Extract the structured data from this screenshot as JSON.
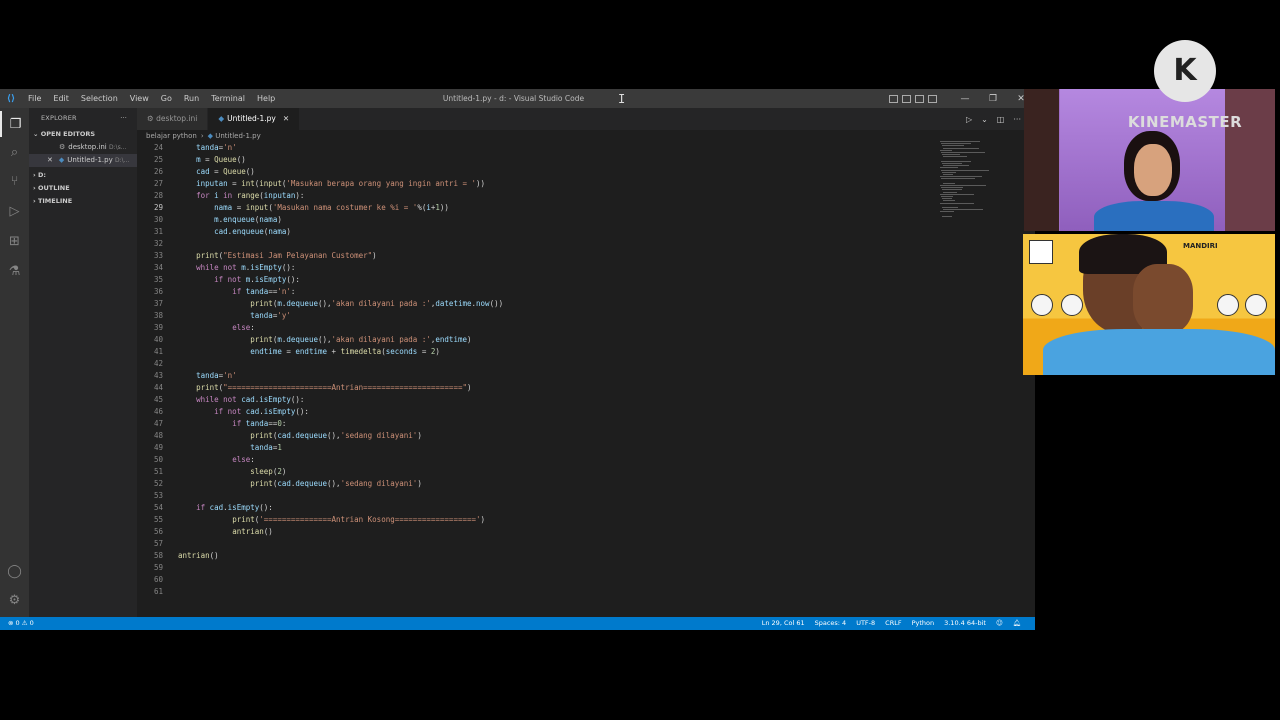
{
  "window": {
    "title": "Untitled-1.py - d: - Visual Studio Code",
    "menu": [
      "File",
      "Edit",
      "Selection",
      "View",
      "Go",
      "Run",
      "Terminal",
      "Help"
    ]
  },
  "sidebar": {
    "header": "EXPLORER",
    "open_editors_label": "OPEN EDITORS",
    "open_editors": [
      {
        "name": "desktop.ini",
        "path": "D:\\s..."
      },
      {
        "name": "Untitled-1.py",
        "path": "D:\\..."
      }
    ],
    "sections": [
      "D:",
      "OUTLINE",
      "TIMELINE"
    ]
  },
  "tabs": [
    {
      "label": "desktop.ini"
    },
    {
      "label": "Untitled-1.py"
    }
  ],
  "breadcrumb": {
    "folder": "belajar python",
    "file": "Untitled-1.py"
  },
  "editor": {
    "lines": [
      {
        "n": "24",
        "indent": 2,
        "text": "tanda='n'"
      },
      {
        "n": "25",
        "indent": 2,
        "text": "m = Queue()"
      },
      {
        "n": "26",
        "indent": 2,
        "text": "cad = Queue()"
      },
      {
        "n": "27",
        "indent": 2,
        "text": "inputan = int(input('Masukan berapa orang yang ingin antri = '))"
      },
      {
        "n": "28",
        "indent": 2,
        "text": "for i in range(inputan):"
      },
      {
        "n": "29",
        "indent": 4,
        "text": "nama = input('Masukan nama costumer ke %i = '%(i+1))"
      },
      {
        "n": "30",
        "indent": 4,
        "text": "m.enqueue(nama)"
      },
      {
        "n": "31",
        "indent": 4,
        "text": "cad.enqueue(nama)"
      },
      {
        "n": "32",
        "indent": 0,
        "text": ""
      },
      {
        "n": "33",
        "indent": 2,
        "text": "print(\"Estimasi Jam Pelayanan Customer\")"
      },
      {
        "n": "34",
        "indent": 2,
        "text": "while not m.isEmpty():"
      },
      {
        "n": "35",
        "indent": 4,
        "text": "if not m.isEmpty():"
      },
      {
        "n": "36",
        "indent": 6,
        "text": "if tanda=='n':"
      },
      {
        "n": "37",
        "indent": 8,
        "text": "print(m.dequeue(),'akan dilayani pada :',datetime.now())"
      },
      {
        "n": "38",
        "indent": 8,
        "text": "tanda='y'"
      },
      {
        "n": "39",
        "indent": 6,
        "text": "else:"
      },
      {
        "n": "40",
        "indent": 8,
        "text": "print(m.dequeue(),'akan dilayani pada :',endtime)"
      },
      {
        "n": "41",
        "indent": 8,
        "text": "endtime = endtime + timedelta(seconds = 2)"
      },
      {
        "n": "42",
        "indent": 0,
        "text": ""
      },
      {
        "n": "43",
        "indent": 2,
        "text": "tanda='n'"
      },
      {
        "n": "44",
        "indent": 2,
        "text": "print(\"=======================Antrian======================\")"
      },
      {
        "n": "45",
        "indent": 2,
        "text": "while not cad.isEmpty():"
      },
      {
        "n": "46",
        "indent": 4,
        "text": "if not cad.isEmpty():"
      },
      {
        "n": "47",
        "indent": 6,
        "text": "if tanda==0:"
      },
      {
        "n": "48",
        "indent": 8,
        "text": "print(cad.dequeue(),'sedang dilayani')"
      },
      {
        "n": "49",
        "indent": 8,
        "text": "tanda=1"
      },
      {
        "n": "50",
        "indent": 6,
        "text": "else:"
      },
      {
        "n": "51",
        "indent": 8,
        "text": "sleep(2)"
      },
      {
        "n": "52",
        "indent": 8,
        "text": "print(cad.dequeue(),'sedang dilayani')"
      },
      {
        "n": "53",
        "indent": 0,
        "text": ""
      },
      {
        "n": "54",
        "indent": 2,
        "text": "if cad.isEmpty():"
      },
      {
        "n": "55",
        "indent": 6,
        "text": "print('===============Antrian Kosong==================')"
      },
      {
        "n": "56",
        "indent": 6,
        "text": "antrian()"
      },
      {
        "n": "57",
        "indent": 0,
        "text": ""
      },
      {
        "n": "58",
        "indent": 0,
        "text": "antrian()"
      },
      {
        "n": "59",
        "indent": 0,
        "text": ""
      },
      {
        "n": "60",
        "indent": 0,
        "text": ""
      },
      {
        "n": "61",
        "indent": 0,
        "text": ""
      }
    ],
    "current_line": "29"
  },
  "statusbar": {
    "problems": "⊗ 0 ⚠ 0",
    "position": "Ln 29, Col 61",
    "spaces": "Spaces: 4",
    "encoding": "UTF-8",
    "eol": "CRLF",
    "language": "Python",
    "interpreter": "3.10.4 64-bit"
  },
  "overlay": {
    "watermark": "KINEMASTER",
    "banner_text": "MANDIRI"
  },
  "colors": {
    "status_bar": "#007acc",
    "editor_bg": "#1e1e1e",
    "keyword": "#c586c0",
    "string": "#ce9178",
    "function": "#dcdcaa"
  }
}
